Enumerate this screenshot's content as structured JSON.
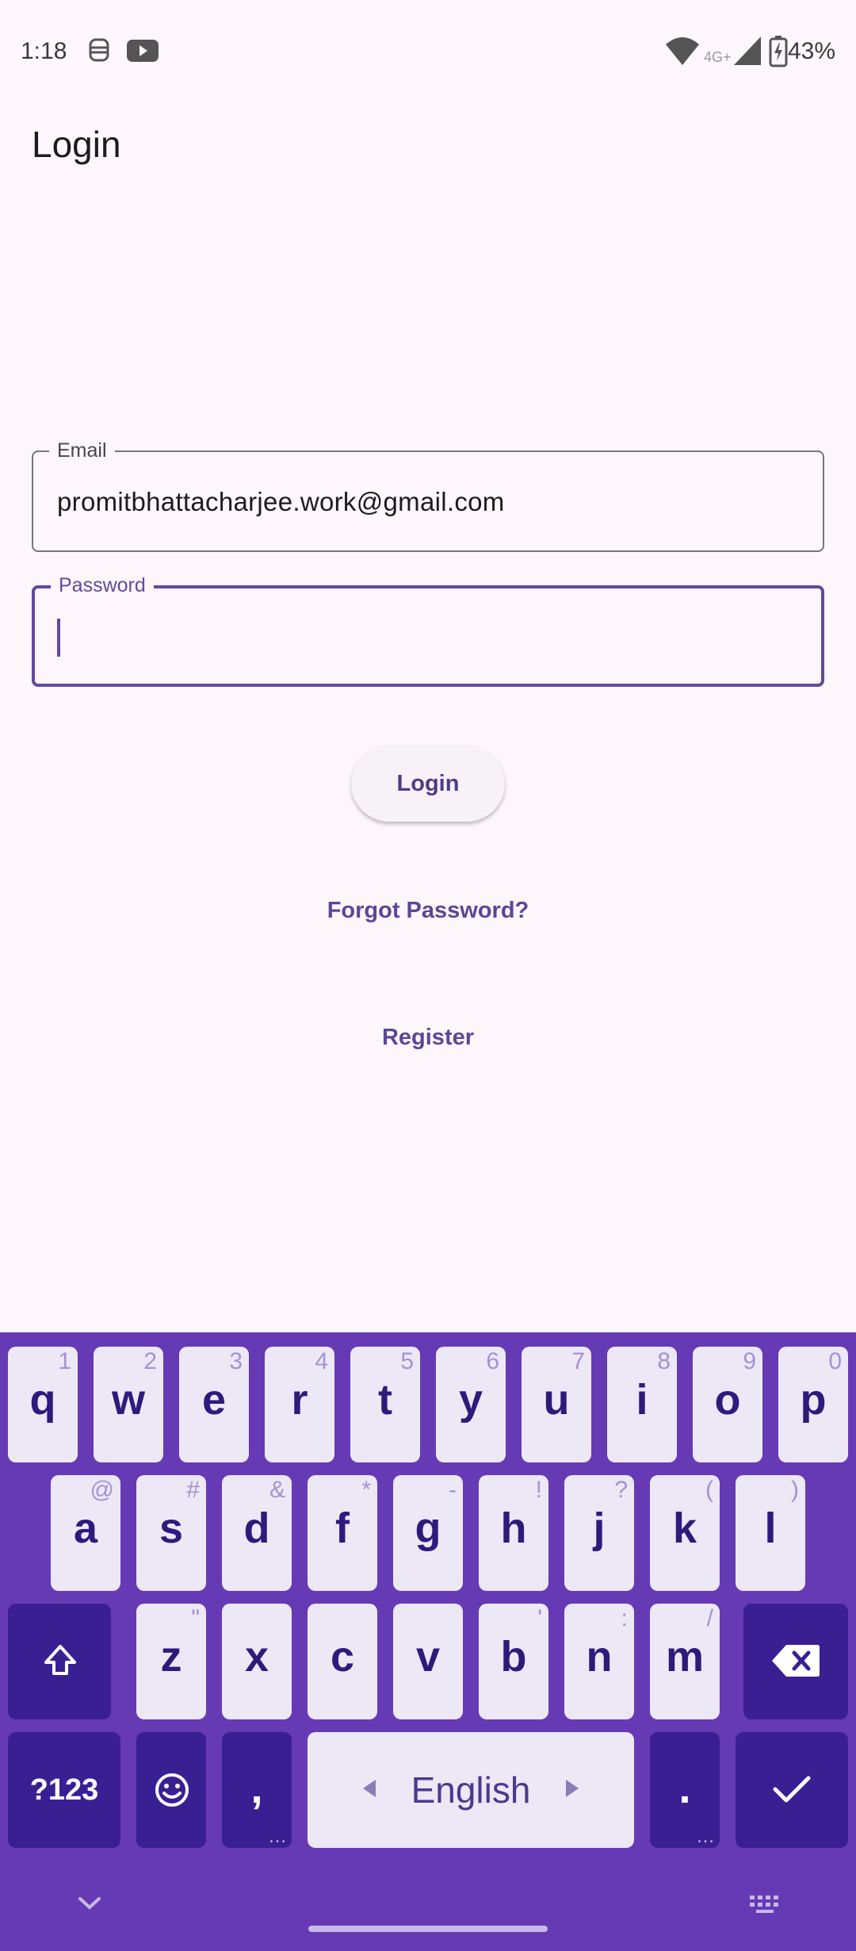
{
  "status_bar": {
    "time": "1:18",
    "battery": "43%",
    "network": "4G+",
    "icons": [
      "face-icon",
      "youtube-icon",
      "wifi-icon",
      "signal-icon",
      "battery-charging-icon"
    ]
  },
  "header": {
    "title": "Login"
  },
  "form": {
    "email": {
      "label": "Email",
      "value": "promitbhattacharjee.work@gmail.com"
    },
    "password": {
      "label": "Password",
      "value": ""
    },
    "login_label": "Login",
    "forgot_label": "Forgot Password?",
    "register_label": "Register"
  },
  "keyboard": {
    "row1": [
      {
        "k": "q",
        "h": "1"
      },
      {
        "k": "w",
        "h": "2"
      },
      {
        "k": "e",
        "h": "3"
      },
      {
        "k": "r",
        "h": "4"
      },
      {
        "k": "t",
        "h": "5"
      },
      {
        "k": "y",
        "h": "6"
      },
      {
        "k": "u",
        "h": "7"
      },
      {
        "k": "i",
        "h": "8"
      },
      {
        "k": "o",
        "h": "9"
      },
      {
        "k": "p",
        "h": "0"
      }
    ],
    "row2": [
      {
        "k": "a",
        "h": "@"
      },
      {
        "k": "s",
        "h": "#"
      },
      {
        "k": "d",
        "h": "&"
      },
      {
        "k": "f",
        "h": "*"
      },
      {
        "k": "g",
        "h": "-"
      },
      {
        "k": "h",
        "h": "!"
      },
      {
        "k": "j",
        "h": "?"
      },
      {
        "k": "k",
        "h": "("
      },
      {
        "k": "l",
        "h": ")"
      }
    ],
    "row3": [
      {
        "k": "z",
        "h": "\""
      },
      {
        "k": "x",
        "h": ""
      },
      {
        "k": "c",
        "h": ""
      },
      {
        "k": "v",
        "h": ""
      },
      {
        "k": "b",
        "h": "'"
      },
      {
        "k": "n",
        "h": ":"
      },
      {
        "k": "m",
        "h": "/"
      }
    ],
    "symbols_label": "?123",
    "comma": ",",
    "space_label": "English",
    "period": ".",
    "colors": {
      "background": "#663ab5",
      "key": "#ece8f5",
      "dark_key": "#3a1f93",
      "key_text": "#2f1a7c"
    }
  },
  "colors": {
    "accent": "#65489e",
    "page_bg": "#fdf7fc"
  }
}
